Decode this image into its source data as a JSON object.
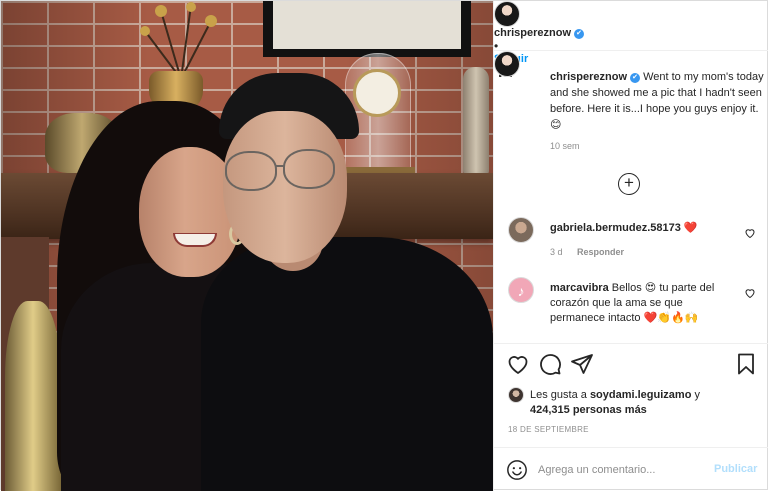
{
  "photo": {
    "alt": "Photo of a young woman and a young man posing in front of a brick fireplace mantel"
  },
  "header": {
    "username": "chrispereznow",
    "verified": "✔",
    "dot": "•",
    "follow_label": "Seguir",
    "more_label": "···"
  },
  "caption": {
    "username": "chrispereznow",
    "verified": "✔",
    "text": "Went to my mom's today and she showed me a pic that I hadn't seen before. Here it is...I hope you guys enjoy it. 😊",
    "time": "10 sem"
  },
  "load_more": "+",
  "comments": [
    {
      "username": "gabriela.bermudez.58173",
      "text": "❤️",
      "time": "3 d",
      "reply_label": "Responder",
      "like_icon": "heart-outline-icon"
    },
    {
      "username": "marcavibra",
      "text": "Bellos 😍 tu parte del corazón que la ama se que permanece intacto ❤️👏🔥🙌",
      "avatar_glyph": "♪",
      "like_icon": "heart-outline-icon"
    }
  ],
  "likes": {
    "prefix": "Les gusta a ",
    "user": "soydami.leguizamo",
    "suffix": " y",
    "others": "424,315 personas más"
  },
  "date": "18 DE SEPTIEMBRE",
  "add_comment": {
    "placeholder": "Agrega un comentario...",
    "publish_label": "Publicar"
  },
  "colors": {
    "accent": "#0095f6",
    "publish_disabled": "#b2dffc",
    "verified": "#3897f0",
    "muted_text": "#8e8e8e",
    "border": "#efefef"
  }
}
